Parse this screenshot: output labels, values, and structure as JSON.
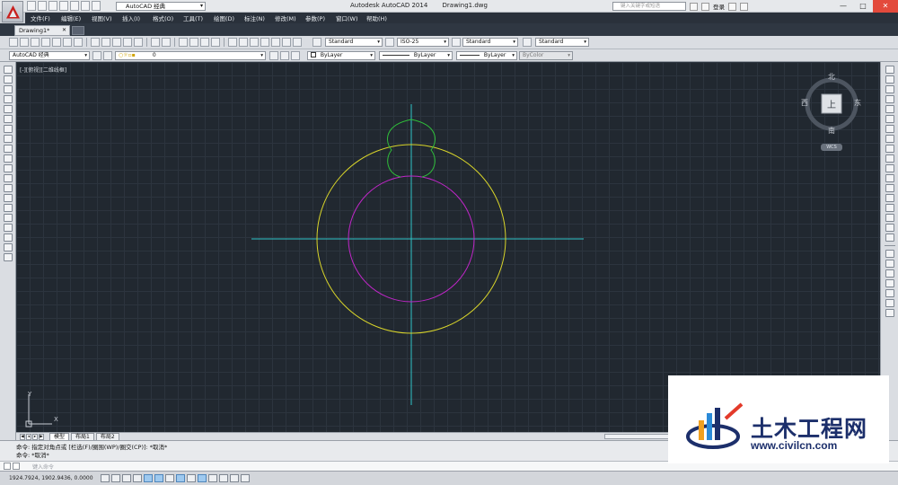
{
  "window": {
    "app_title": "Autodesk AutoCAD 2014",
    "file_title": "Drawing1.dwg",
    "workspace": "AutoCAD 经典",
    "search_placeholder": "键入关键字或短语",
    "login_label": "登录",
    "controls": [
      "—",
      "□",
      "✕"
    ]
  },
  "menu": {
    "items": [
      "文件(F)",
      "编辑(E)",
      "视图(V)",
      "插入(I)",
      "格式(O)",
      "工具(T)",
      "绘图(D)",
      "标注(N)",
      "修改(M)",
      "参数(P)",
      "窗口(W)",
      "帮助(H)"
    ]
  },
  "tabs": {
    "document": "Drawing1*",
    "close_glyph": "✕"
  },
  "toolbar_styles": {
    "text_style": "Standard",
    "dim_style": "ISO-25",
    "table_style": "Standard",
    "multileader_style": "Standard"
  },
  "toolbar_layers": {
    "workspace": "AutoCAD 经典",
    "current_layer": "0",
    "color": "ByLayer",
    "linetype": "ByLayer",
    "lineweight": "ByLayer",
    "plot_style": "ByColor"
  },
  "viewport": {
    "label": "[-][俯视][二维线框]",
    "viewcube": {
      "north": "北",
      "south": "南",
      "east": "东",
      "west": "西",
      "top": "上"
    },
    "wcs": "WCS",
    "ucs_x": "X",
    "ucs_y": "Y"
  },
  "drawing_colors": {
    "background": "#212830",
    "centerlines": "#2ec4c8",
    "outer_circle": "#d9d52a",
    "inner_circle": "#c026c8",
    "top_profile": "#2fbf3a"
  },
  "layout_tabs": [
    "模型",
    "布局1",
    "布局2"
  ],
  "command": {
    "history": [
      "命令: 指定对角点或 [栏选(F)/圈围(WP)/圈交(CP)]: *取消*",
      "命令: *取消*"
    ],
    "placeholder": "键入命令"
  },
  "status": {
    "coords": "1924.7924, 1902.9436, 0.0000"
  },
  "watermark": {
    "name": "土木工程网",
    "url": "www.civilcn.com"
  }
}
